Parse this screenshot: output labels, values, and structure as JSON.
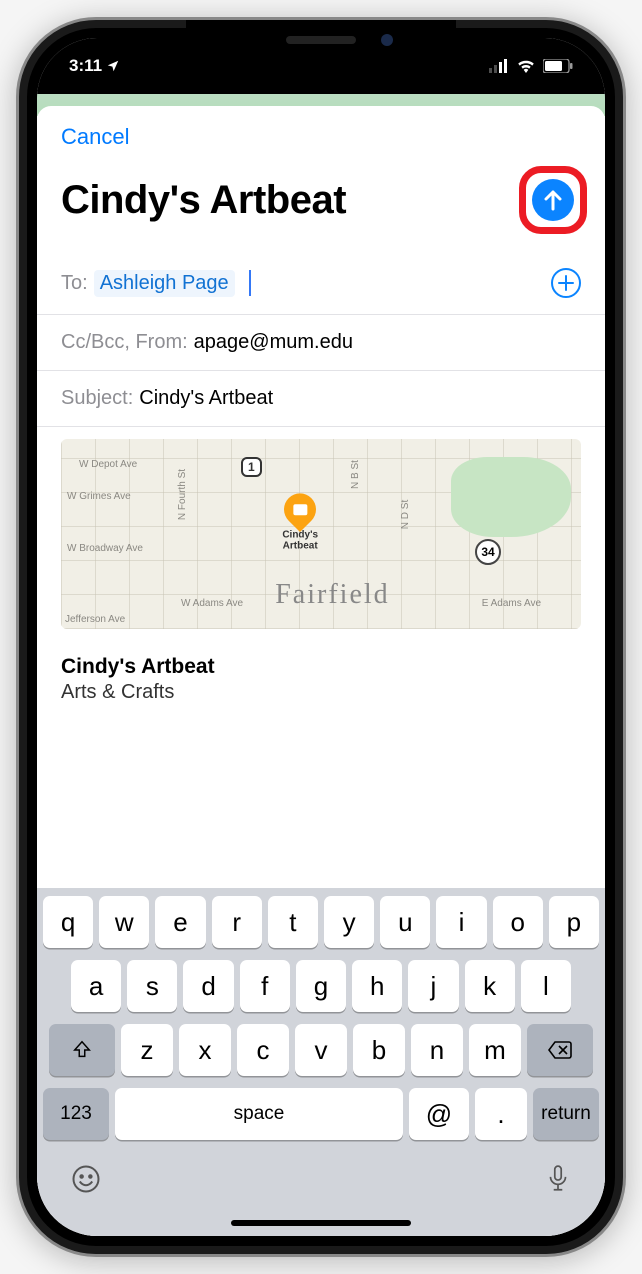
{
  "statusbar": {
    "time": "3:11"
  },
  "compose": {
    "cancel_label": "Cancel",
    "title": "Cindy's Artbeat",
    "to_label": "To:",
    "recipient": "Ashleigh Page",
    "ccbcc_label": "Cc/Bcc, From:",
    "from_email": "apage@mum.edu",
    "subject_label": "Subject:",
    "subject_value": "Cindy's Artbeat"
  },
  "map": {
    "city": "Fairfield",
    "pin_name": "Cindy's Artbeat",
    "route1": "1",
    "route34": "34",
    "streets": {
      "depot": "W Depot Ave",
      "grimes": "W Grimes Ave",
      "broadway": "W Broadway Ave",
      "jefferson": "Jefferson Ave",
      "adams_w": "W Adams Ave",
      "adams_e": "E Adams Ave",
      "fourth": "N Fourth St",
      "nb": "N B St",
      "nd": "N D St"
    }
  },
  "body": {
    "name": "Cindy's Artbeat",
    "category": "Arts & Crafts"
  },
  "keyboard": {
    "row1": [
      "q",
      "w",
      "e",
      "r",
      "t",
      "y",
      "u",
      "i",
      "o",
      "p"
    ],
    "row2": [
      "a",
      "s",
      "d",
      "f",
      "g",
      "h",
      "j",
      "k",
      "l"
    ],
    "row3": [
      "z",
      "x",
      "c",
      "v",
      "b",
      "n",
      "m"
    ],
    "k123": "123",
    "space": "space",
    "at": "@",
    "dot": ".",
    "return": "return"
  }
}
